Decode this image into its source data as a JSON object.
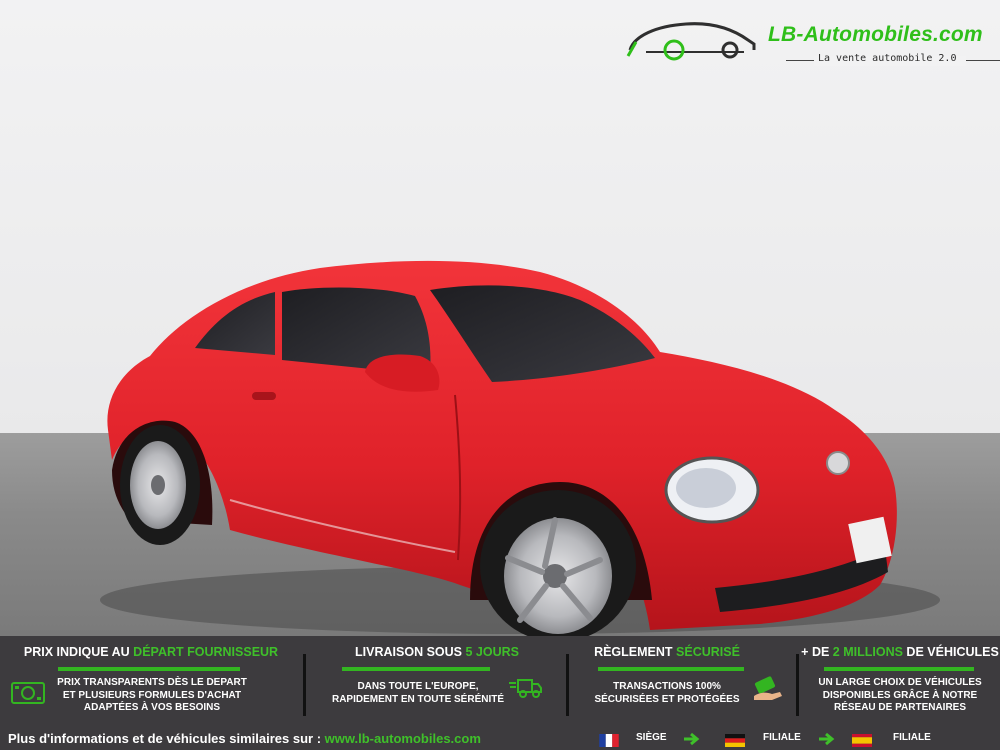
{
  "brand": {
    "name": "LB-Automobiles.com",
    "tagline": "La vente automobile 2.0",
    "brand_color": "#2fbf1a"
  },
  "photo": {
    "subject": "Red Volkswagen Beetle coupe",
    "car_color": "#e5232a"
  },
  "banner": {
    "background": "#3d3b3e",
    "accent": "#3fc02a",
    "features": [
      {
        "title_pre": "PRIX INDIQUE AU ",
        "title_hl": "DÉPART FOURNISSEUR",
        "title_post": "",
        "lines": [
          "PRIX TRANSPARENTS DÈS LE DEPART",
          "ET PLUSIEURS FORMULES D'ACHAT",
          "ADAPTÉES À VOS BESOINS"
        ],
        "icon": "money-icon"
      },
      {
        "title_pre": "LIVRAISON SOUS ",
        "title_hl": "5 JOURS",
        "title_post": "",
        "lines": [
          "DANS TOUTE L'EUROPE,",
          "RAPIDEMENT EN TOUTE SÉRÉNITÉ"
        ],
        "icon": "delivery-truck-icon"
      },
      {
        "title_pre": "RÈGLEMENT ",
        "title_hl": "SÉCURISÉ",
        "title_post": "",
        "lines": [
          "TRANSACTIONS 100%",
          "SÉCURISÉES ET PROTÉGÉES"
        ],
        "icon": "secure-payment-icon"
      },
      {
        "title_pre": "+ DE ",
        "title_hl": "2 MILLIONS",
        "title_post": " DE VÉHICULES",
        "lines": [
          "UN LARGE CHOIX DE VÉHICULES",
          "DISPONIBLES GRÂCE À NOTRE",
          "RÉSEAU DE PARTENAIRES"
        ],
        "icon": ""
      }
    ],
    "footer": {
      "text": "Plus d'informations et de véhicules similaires sur : ",
      "url": "www.lb-automobiles.com",
      "locations": [
        {
          "flag": "france-flag",
          "label": "SIÈGE"
        },
        {
          "flag": "germany-flag",
          "label": "FILIALE"
        },
        {
          "flag": "spain-flag",
          "label": "FILIALE"
        }
      ]
    }
  }
}
